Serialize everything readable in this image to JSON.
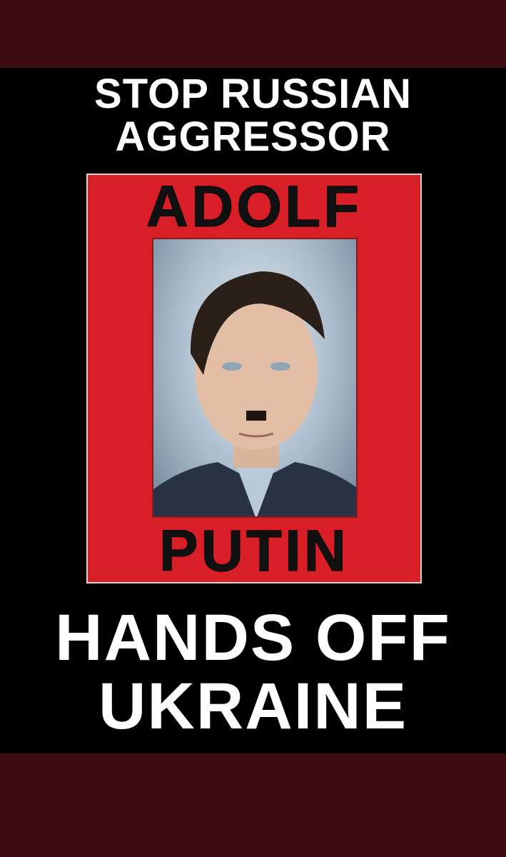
{
  "poster": {
    "headline_line1": "STOP RUSSIAN",
    "headline_line2": "AGGRESSOR",
    "frame_top_name": "ADOLF",
    "frame_bottom_name": "PUTIN",
    "footer_line1": "HANDS OFF",
    "footer_line2": "UKRAINE"
  },
  "colors": {
    "band": "#3b0b10",
    "background": "#000000",
    "frame_red": "#d81e26",
    "text": "#ffffff"
  }
}
